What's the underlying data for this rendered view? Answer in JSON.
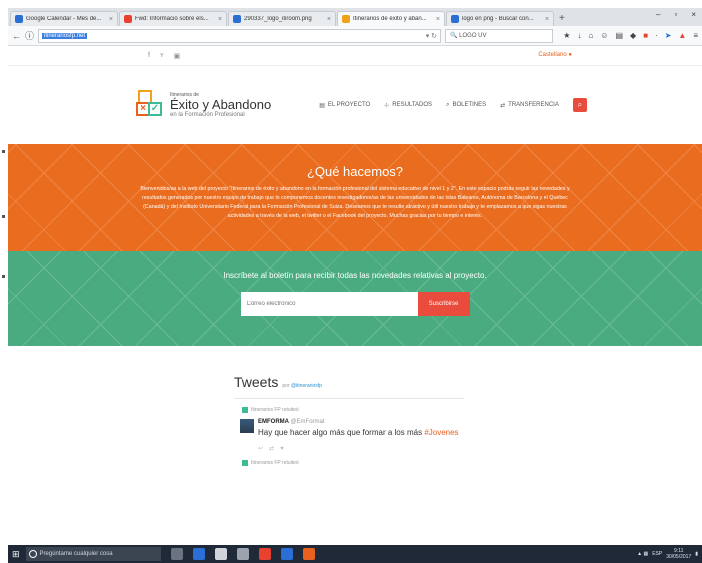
{
  "browser": {
    "tabs": [
      {
        "label": "Google Calendar - Mes de...",
        "color": "#2b6fd6"
      },
      {
        "label": "Fwd: Informació sobre els...",
        "color": "#e8412f"
      },
      {
        "label": "290337_logo_itiroom.png",
        "color": "#2b6fd6"
      },
      {
        "label": "Itinerarios de éxito y aban...",
        "color": "#f0a21b"
      },
      {
        "label": "logo en png - Buscar con...",
        "color": "#2b6fd6"
      }
    ],
    "url": "itinerariosfp.net",
    "search_value": "LOGO UV"
  },
  "site": {
    "language": "Castellano",
    "social_icons": [
      "facebook-icon",
      "twitter-icon",
      "youtube-icon"
    ],
    "logo": {
      "small": "Itinerarios de",
      "big": "Éxito y Abandono",
      "sub": "en la Formación Profesional"
    },
    "menu": [
      {
        "icon": "document-icon",
        "label": "EL PROYECTO"
      },
      {
        "icon": "chart-icon",
        "label": "RESULTADOS"
      },
      {
        "icon": "newsletter-icon",
        "label": "BOLETINES"
      },
      {
        "icon": "transfer-icon",
        "label": "TRANSFERENCIA"
      }
    ],
    "about": {
      "title": "¿Qué hacemos?",
      "text": "Bienvenidos/as a la web del proyecto \"Itinerarios de éxito y abandono en la formación profesional del sistema educativo de nivel 1 y 2\". En este espacio podrás seguir las novedades y resultados generados por nuestro equipo de trabajo que lo componemos docentes investigadores/as de las universidades de las Islas Baleares, Autónoma de Barcelona y el Québec (Canadá) y del Instituto Universitario Federal para la Formación Profesional de Suiza. Deseamos que te resulte atractivo y útil nuestro trabajo y te emplazamos a que sigas nuestras actividades a través de la web, el twitter o el Facebook del proyecto. Muchas gracias por tu tiempo e interés."
    },
    "newsletter": {
      "title": "Inscríbete al boletín para recibir todas las novedades relativas al proyecto.",
      "placeholder": "Correo electrónico",
      "button": "Suscribirse"
    },
    "tweets": {
      "title": "Tweets",
      "by": "por",
      "handle": "@itinerariosfp",
      "retweeted_by": "Itinerarios FP retuiteó",
      "items": [
        {
          "name": "EMFORMA",
          "handle": "@EmFormat",
          "text_before": "Hay que hacer algo más que formar a los más",
          "hashtag": "#Jovenes"
        }
      ]
    }
  },
  "taskbar": {
    "search_placeholder": "Pregúntame cualquier cosa",
    "lang": "ESP",
    "time": "9:11",
    "date": "30/05/2017"
  }
}
